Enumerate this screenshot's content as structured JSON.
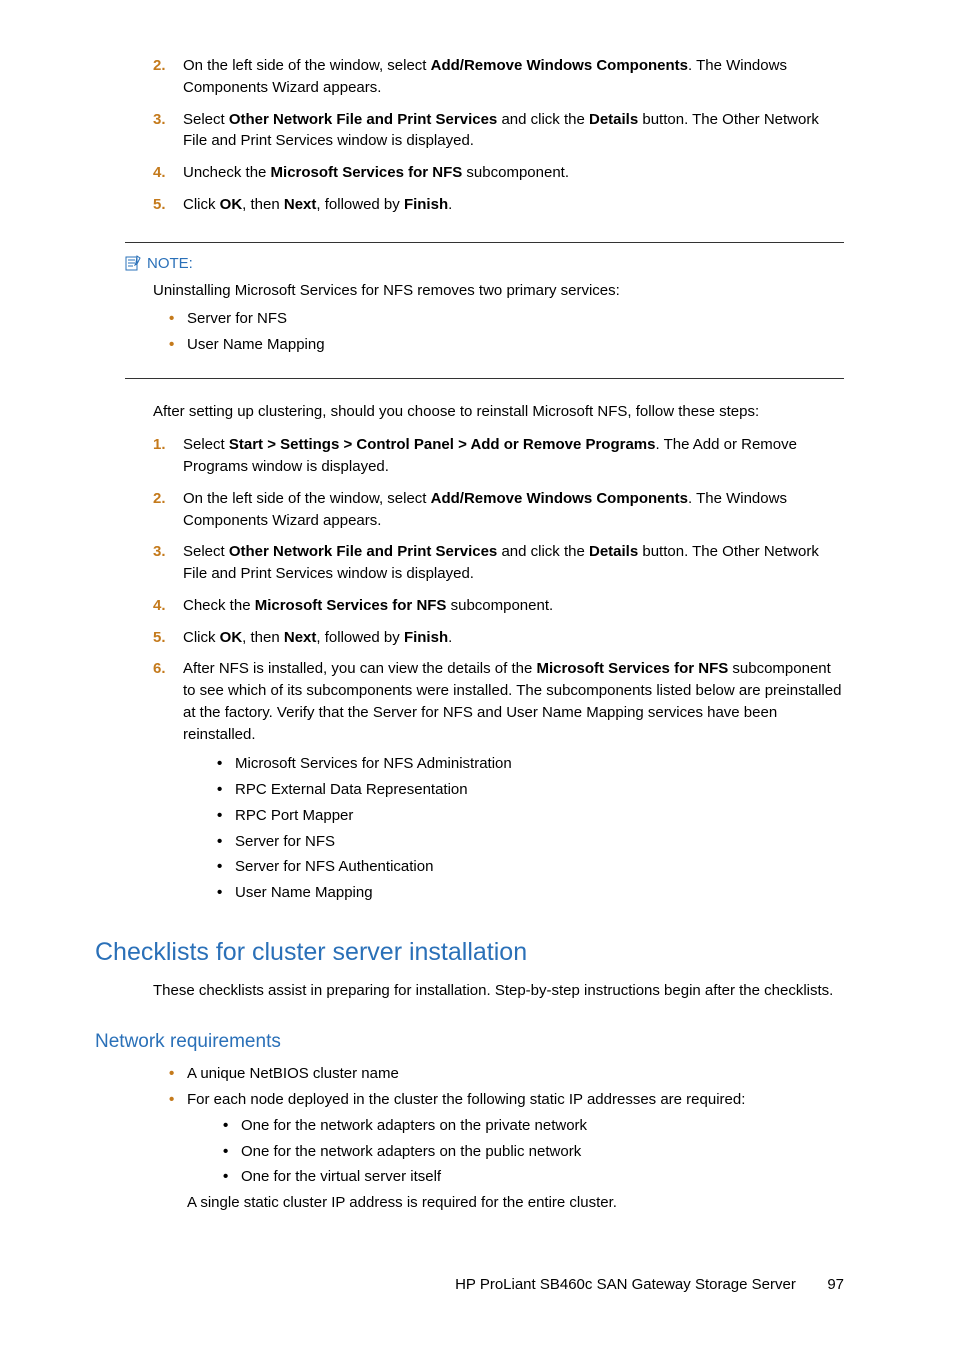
{
  "stepsA": {
    "s2a": "On the left side of the window, select ",
    "s2b": "Add/Remove Windows Components",
    "s2c": ". The Windows Components Wizard appears.",
    "s3a": "Select ",
    "s3b": "Other Network File and Print Services",
    "s3c": " and click the ",
    "s3d": "Details",
    "s3e": " button. The Other Network File and Print Services window is displayed.",
    "s4a": "Uncheck the ",
    "s4b": "Microsoft Services for NFS",
    "s4c": " subcomponent.",
    "s5a": "Click ",
    "s5b": "OK",
    "s5c": ", then ",
    "s5d": "Next",
    "s5e": ", followed by ",
    "s5f": "Finish",
    "s5g": "."
  },
  "note": {
    "label": "NOTE:",
    "intro": "Uninstalling Microsoft Services for NFS removes two primary services:",
    "b1": "Server for NFS",
    "b2": "User Name Mapping"
  },
  "afterPara": "After setting up clustering, should you choose to reinstall Microsoft NFS, follow these steps:",
  "stepsB": {
    "s1a": "Select ",
    "s1b": "Start > Settings > Control Panel > Add or Remove Programs",
    "s1c": ". The Add or Remove Programs window is displayed.",
    "s2a": "On the left side of the window, select ",
    "s2b": "Add/Remove Windows Components",
    "s2c": ". The Windows Components Wizard appears.",
    "s3a": "Select ",
    "s3b": "Other Network File and Print Services",
    "s3c": " and click the ",
    "s3d": "Details",
    "s3e": " button. The Other Network File and Print Services window is displayed.",
    "s4a": "Check the ",
    "s4b": "Microsoft Services for NFS",
    "s4c": " subcomponent.",
    "s5a": "Click ",
    "s5b": "OK",
    "s5c": ", then ",
    "s5d": "Next",
    "s5e": ", followed by ",
    "s5f": "Finish",
    "s5g": ".",
    "s6a": "After NFS is installed, you can view the details of the ",
    "s6b": "Microsoft Services for NFS",
    "s6c": " subcomponent to see which of its subcomponents were installed. The subcomponents listed below are preinstalled at the factory. Verify that the Server for NFS and User Name Mapping services have been reinstalled.",
    "sub": [
      "Microsoft Services for NFS Administration",
      "RPC External Data Representation",
      "RPC Port Mapper",
      "Server for NFS",
      "Server for NFS Authentication",
      "User Name Mapping"
    ]
  },
  "h1": "Checklists for cluster server installation",
  "h1para": "These checklists assist in preparing for installation. Step-by-step instructions begin after the checklists.",
  "h2": "Network requirements",
  "net": {
    "b1": "A unique NetBIOS cluster name",
    "b2": "For each node deployed in the cluster the following static IP addresses are required:",
    "sub": [
      "One for the network adapters on the private network",
      "One for the network adapters on the public network",
      "One for the virtual server itself"
    ],
    "trail": "A single static cluster IP address is required for the entire cluster."
  },
  "footer": {
    "title": "HP ProLiant SB460c SAN Gateway Storage Server",
    "page": "97"
  }
}
